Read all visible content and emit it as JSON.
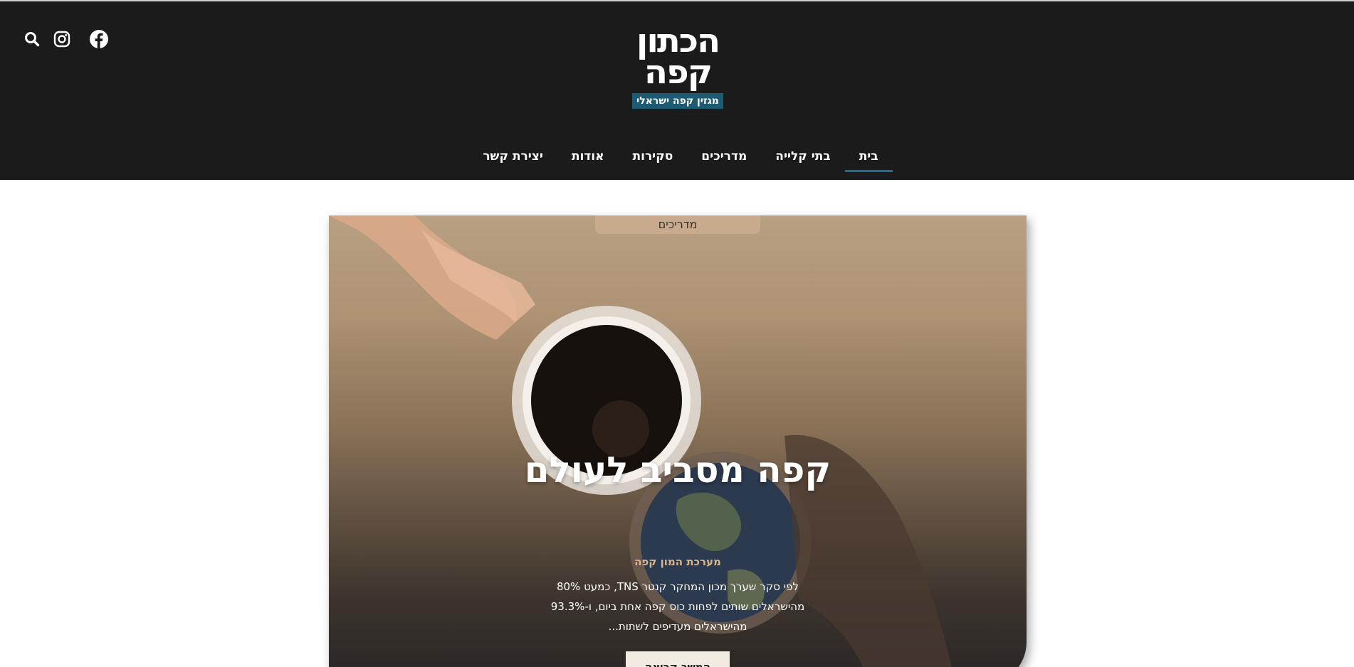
{
  "header": {
    "logo_line1": "הכתון",
    "logo_line2": "קפה",
    "logo_tagline": "מגזין קפה ישראלי",
    "icons": [
      "search-icon",
      "instagram-icon",
      "facebook-icon"
    ]
  },
  "nav": {
    "items": [
      {
        "label": "בית",
        "active": true
      },
      {
        "label": "בתי קלייה"
      },
      {
        "label": "מדריכים"
      },
      {
        "label": "סקירות"
      },
      {
        "label": "אודות"
      },
      {
        "label": "יצירת קשר"
      }
    ]
  },
  "hero": {
    "category": "מדריכים",
    "title": "קפה מסביב לעולם",
    "author": "מערכת המון קפה",
    "excerpt": "לפי סקר שערך מכון המחקר קנטר TNS, כמעט 80% מהישראלים שותים לפחות כוס קפה אחת ביום, ו-93.3% מהישראלים מעדיפים לשתות...",
    "button": "המשך קריאה"
  },
  "colors": {
    "header_bg": "#1b1b1b",
    "accent": "#1f6f95",
    "tagline_bg": "#1d5a74",
    "author": "#d9b690"
  }
}
